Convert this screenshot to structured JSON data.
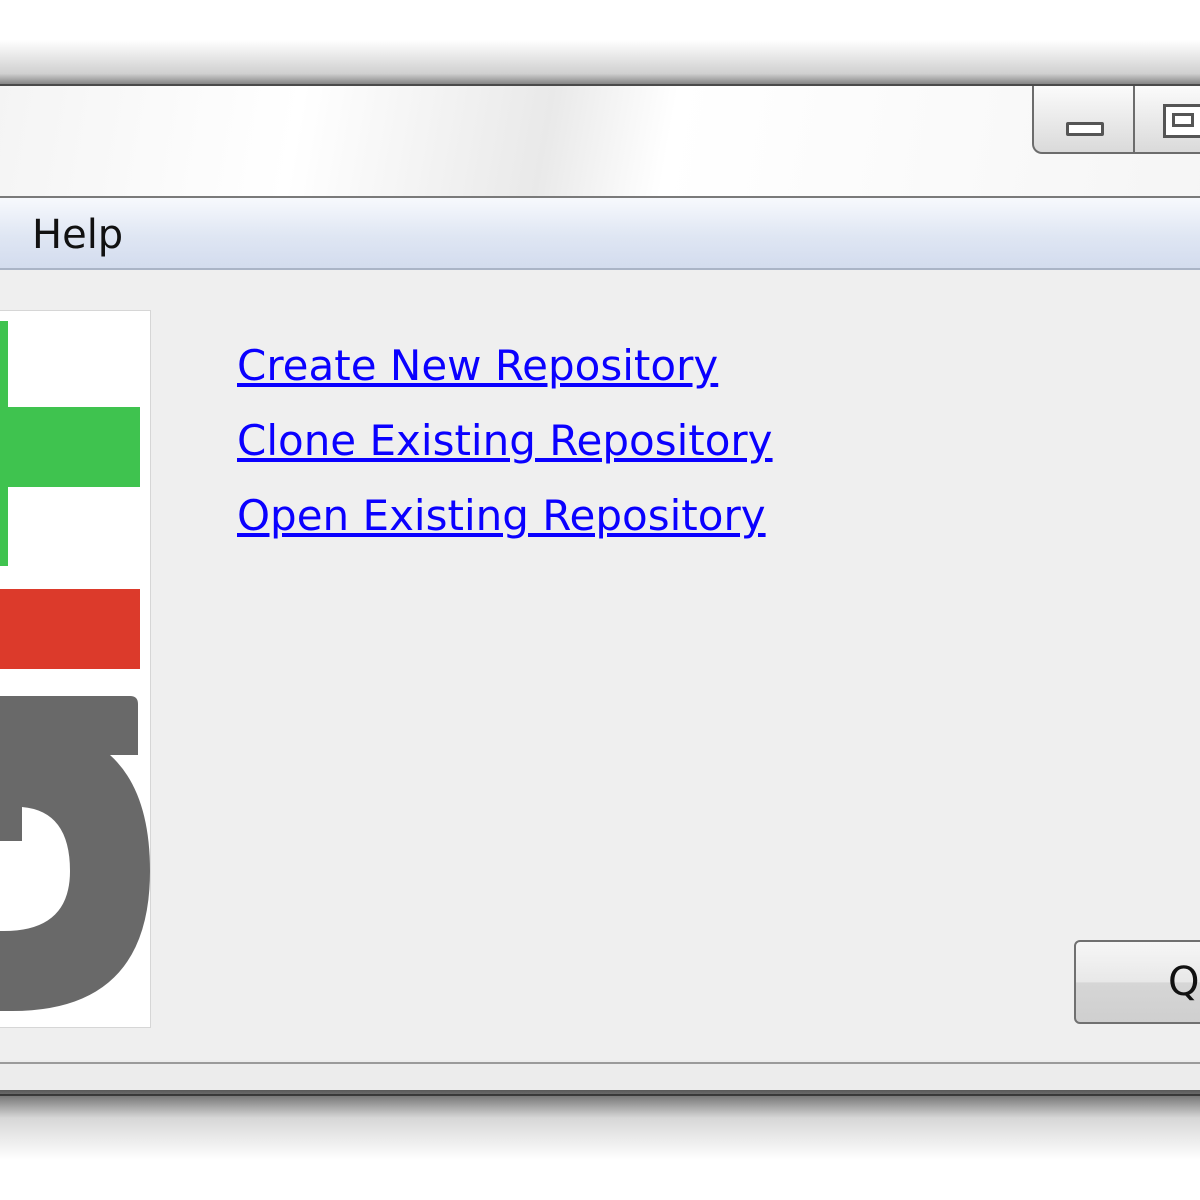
{
  "window": {
    "caption_buttons": [
      {
        "name": "minimize",
        "icon": "minimize-icon"
      },
      {
        "name": "maximize",
        "icon": "maximize-icon"
      }
    ]
  },
  "menubar": {
    "items": [
      {
        "label": "Help"
      }
    ]
  },
  "logo": {
    "icon": "git-logo",
    "colors": {
      "green": "#3fc34f",
      "red": "#dc3a2b",
      "gray": "#696969"
    }
  },
  "actions": {
    "links": [
      {
        "label": "Create New Repository"
      },
      {
        "label": "Clone Existing Repository"
      },
      {
        "label": "Open Existing Repository"
      }
    ],
    "link_color": "#0a00ff"
  },
  "footer": {
    "quit_label": "Q"
  }
}
